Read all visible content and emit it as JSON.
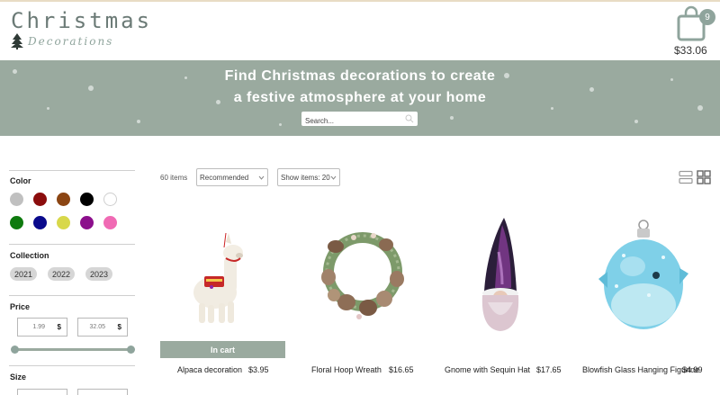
{
  "header": {
    "logo_title": "Christmas",
    "logo_subtitle": "Decorations",
    "cart_count": "9",
    "cart_total": "$33.06"
  },
  "banner": {
    "line1": "Find Christmas decorations to create",
    "line2": "a festive atmosphere at your home",
    "search_placeholder": "Search..."
  },
  "filters": {
    "color": {
      "title": "Color",
      "swatches": [
        "#c0c0c0",
        "#8b0d0d",
        "#8b4513",
        "#000000",
        "#ffffff",
        "#0e7a0e",
        "#0a0a8c",
        "#d8d84a",
        "#8c0f8c",
        "#f06ab4"
      ]
    },
    "collection": {
      "title": "Collection",
      "years": [
        "2021",
        "2022",
        "2023"
      ]
    },
    "price": {
      "title": "Price",
      "min": "1.99",
      "max": "32.05",
      "currency": "$"
    },
    "size": {
      "title": "Size"
    }
  },
  "toolbar": {
    "items_count": "60 items",
    "sort_selected": "Recommended",
    "show_selected": "Show items: 20"
  },
  "products": [
    {
      "name": "Alpaca decoration",
      "price": "$3.95",
      "in_cart_label": "In cart"
    },
    {
      "name": "Floral Hoop Wreath",
      "price": "$16.65"
    },
    {
      "name": "Gnome with Sequin Hat",
      "price": "$17.65"
    },
    {
      "name": "Blowfish Glass Hanging Figurine",
      "price": "$4.99"
    }
  ],
  "colors": {
    "accent": "#9aaa9f",
    "logo": "#6b7a76"
  }
}
